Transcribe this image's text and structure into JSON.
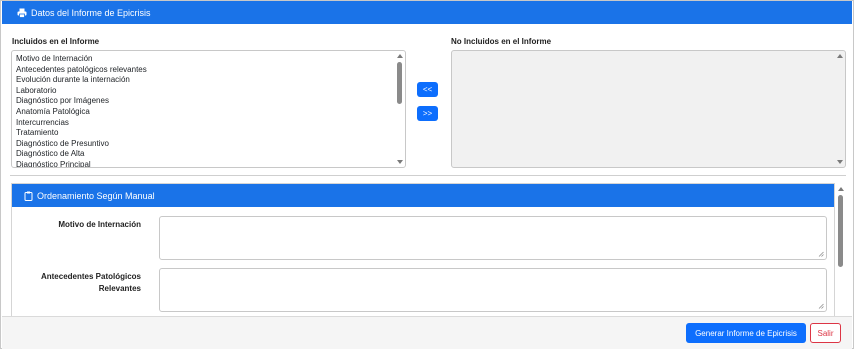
{
  "header": {
    "title": "Datos del Informe de Epicrisis",
    "icon": "printer-icon"
  },
  "included": {
    "label": "Incluidos en el Informe",
    "items": [
      "Motivo de Internación",
      "Antecedentes patológicos relevantes",
      "Evolución durante la internación",
      "Laboratorio",
      "Diagnóstico por Imágenes",
      "Anatomía Patológica",
      "Intercurrencias",
      "Tratamiento",
      "Diagnóstico de Presuntivo",
      "Diagnóstico de Alta",
      "Diagnóstico Principal"
    ]
  },
  "not_included": {
    "label": "No Incluidos en el Informe",
    "items": []
  },
  "move": {
    "left_label": "<<",
    "right_label": ">>"
  },
  "ordering": {
    "title": "Ordenamiento Según Manual",
    "icon": "clipboard-icon",
    "fields": [
      {
        "label": "Motivo de Internación",
        "value": ""
      },
      {
        "label_line1": "Antecedentes Patológicos",
        "label_line2": "Relevantes",
        "value": ""
      }
    ]
  },
  "footer": {
    "generate_label": "Generar Informe de Epicrisis",
    "exit_label": "Salir"
  },
  "colors": {
    "primary": "#0d6efd",
    "header": "#1a73e8",
    "danger": "#dc3545"
  }
}
